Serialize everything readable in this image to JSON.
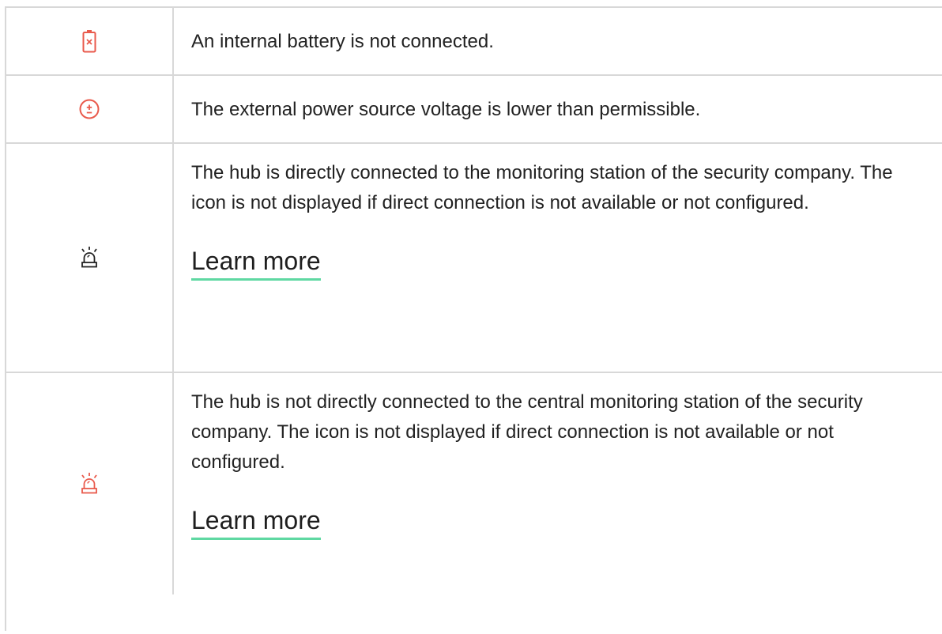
{
  "colors": {
    "grid": "#d8d8d8",
    "alert_red": "#e95a4c",
    "text": "#222222",
    "link_underline": "#5fd8a2"
  },
  "rows": [
    {
      "icon": "battery-disconnected-icon",
      "text": "An internal battery is not connected."
    },
    {
      "icon": "power-voltage-icon",
      "text": "The external power source voltage is lower than permissible."
    },
    {
      "icon": "siren-icon",
      "text": "The hub is directly connected to the monitoring station of the security company. The icon is not displayed if direct connection is not available or not configured.",
      "link": "Learn more"
    },
    {
      "icon": "siren-red-icon",
      "text": "The hub is not directly connected to the central monitoring station of the security company. The icon is not displayed if direct connection is not available or not configured.",
      "link": "Learn more"
    }
  ]
}
